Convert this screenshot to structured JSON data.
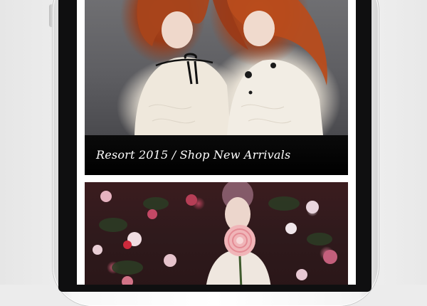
{
  "screen": {
    "promo_card": {
      "caption": "Resort 2015 / Shop New Arrivals"
    },
    "second_card": {}
  },
  "colors": {
    "caption_bar": "#000000",
    "caption_text": "#ffffff",
    "device_bezel": "#0f0f10",
    "device_body": "#f5f5f5"
  }
}
